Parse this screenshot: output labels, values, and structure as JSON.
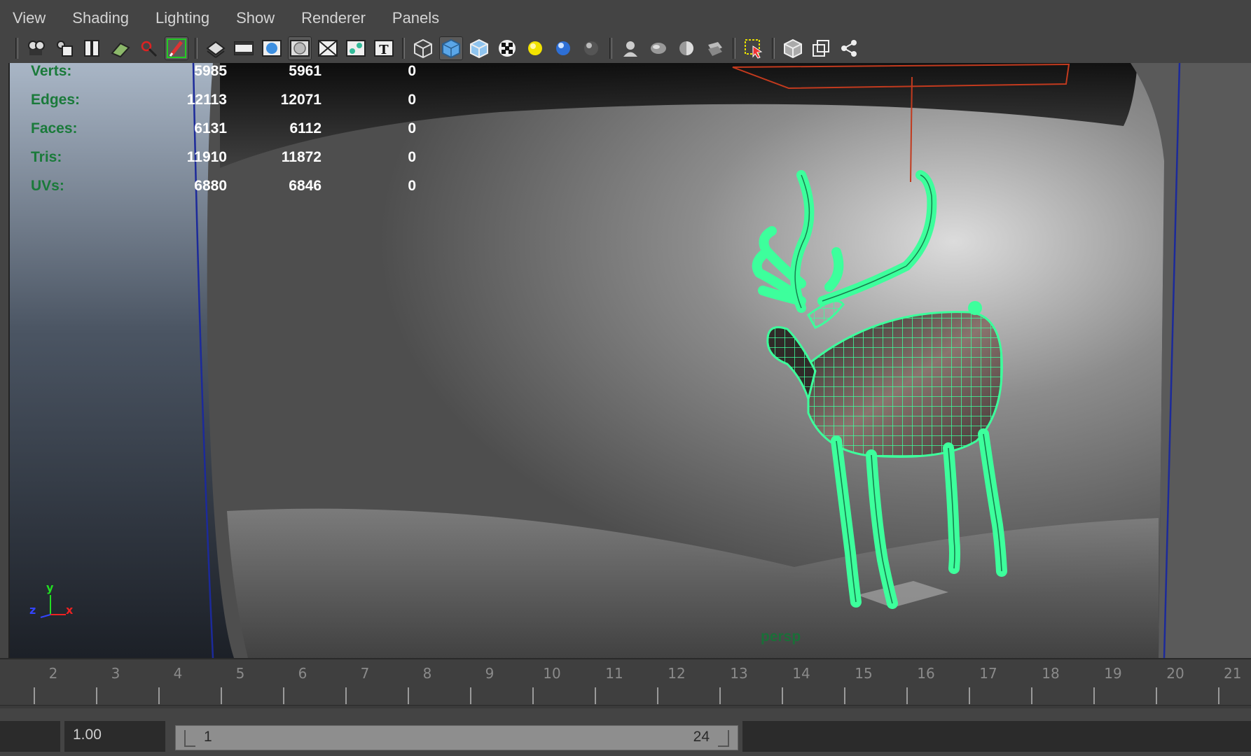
{
  "menu": {
    "items": [
      "View",
      "Shading",
      "Lighting",
      "Show",
      "Renderer",
      "Panels"
    ]
  },
  "toolbar": {
    "groups": [
      [
        "camera-attributes-icon",
        "bookmarks-icon",
        "image-plane-icon",
        "grid-icon",
        "pan-zoom-icon",
        "grease-pencil-icon"
      ],
      [
        "gate-mask-icon",
        "film-gate-icon",
        "resolution-gate-icon",
        "field-chart-icon",
        "safe-action-icon",
        "safe-title-icon"
      ],
      [
        "wireframe-icon",
        "smooth-shade-icon",
        "wireframe-on-shaded-icon",
        "textured-icon",
        "lighting-default-icon",
        "lighting-all-icon",
        "lighting-none-icon"
      ],
      [
        "shadows-icon",
        "screen-space-ao-icon",
        "motion-blur-icon",
        "anti-alias-icon"
      ],
      [
        "isolate-select-icon"
      ],
      [
        "xray-icon",
        "xray-joints-icon",
        "xray-components-icon"
      ]
    ]
  },
  "hud": {
    "rows": [
      {
        "label": "Verts:",
        "v1": "5985",
        "v2": "5961",
        "v3": "0"
      },
      {
        "label": "Edges:",
        "v1": "12113",
        "v2": "12071",
        "v3": "0"
      },
      {
        "label": "Faces:",
        "v1": "6131",
        "v2": "6112",
        "v3": "0"
      },
      {
        "label": "Tris:",
        "v1": "11910",
        "v2": "11872",
        "v3": "0"
      },
      {
        "label": "UVs:",
        "v1": "6880",
        "v2": "6846",
        "v3": "0"
      }
    ]
  },
  "viewport": {
    "camera_name": "persp",
    "axis": {
      "x": "x",
      "y": "y",
      "z": "z"
    },
    "colors": {
      "wireframe": "#3dff9c",
      "light": "#c23a1e",
      "hud_label": "#1a7a3a"
    }
  },
  "timeline": {
    "ticks": [
      "2",
      "3",
      "4",
      "5",
      "6",
      "7",
      "8",
      "9",
      "10",
      "11",
      "12",
      "13",
      "14",
      "15",
      "16",
      "17",
      "18",
      "19",
      "20",
      "21"
    ]
  },
  "range": {
    "start_time": "1.00",
    "playback_start": "1",
    "playback_end": "24"
  }
}
